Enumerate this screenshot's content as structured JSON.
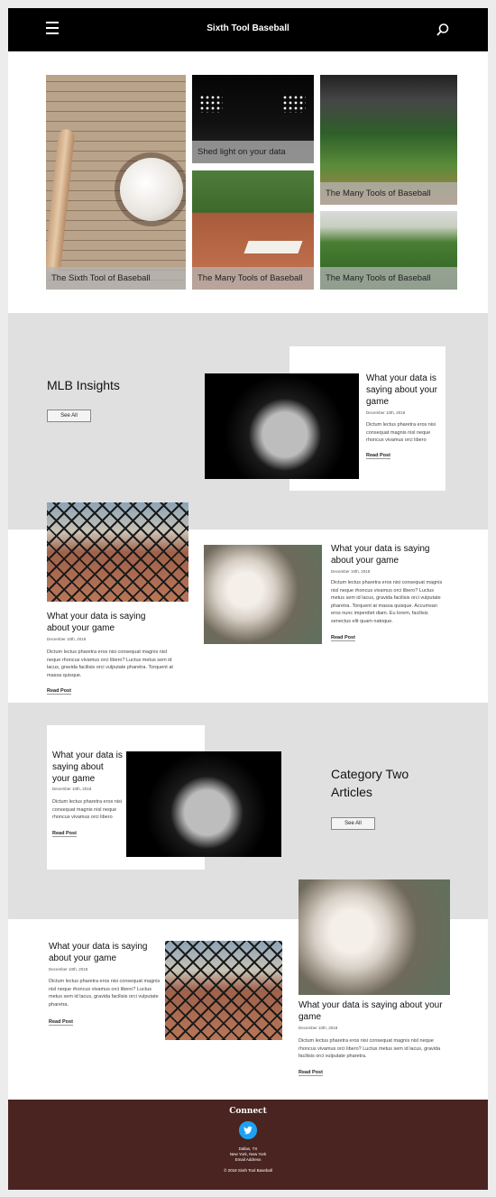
{
  "header": {
    "brand": "Sixth Tool Baseball",
    "menu_icon": "hamburger-icon",
    "search_icon": "search-icon"
  },
  "hero": {
    "tiles": [
      {
        "caption": "The Sixth Tool of Baseball"
      },
      {
        "caption": "Shed light on your data"
      },
      {
        "caption": "The Many Tools of Baseball"
      },
      {
        "caption": "The Many Tools of Baseball"
      },
      {
        "caption": "The Many Tools of Baseball"
      }
    ]
  },
  "mlb": {
    "title": "MLB Insights",
    "see_all": "See All",
    "featured": {
      "title": "What your data is saying about your game",
      "date": "December 10th, 2018",
      "excerpt": "Dictum lectus pharetra eros nisi consequat magnis nisl neque rhoncus vivamus orci libero",
      "read": "Read Post"
    },
    "posts": [
      {
        "title": "What your data is saying about your game",
        "date": "December 10th, 2018",
        "excerpt": "Dictum lectus pharetra eros nisi consequat magnis nisl neque rhoncus vivamus orci libero? Luctus metus sem id lacus, gravida facilisis orci vulputate pharetra. Torquent at massa quisque.",
        "read": "Read Post"
      },
      {
        "title": "What your data is saying about your game",
        "date": "December 10th, 2018",
        "excerpt": "Dictum lectus pharetra eros nisi consequat magnis nisl neque rhoncus vivamus orci libero? Luctus metus sem id lacus, gravida facilisis orci vulputate pharetra. Torquent at massa quisque. Accumsan eros nunc imperdiet diam. Eu lorem, facilisis senectus elit quam natoque.",
        "read": "Read Post"
      }
    ]
  },
  "cat2": {
    "title": "Category Two Articles",
    "see_all": "See All",
    "featured": {
      "title": "What your data is saying about your game",
      "date": "December 10th, 2018",
      "excerpt": "Dictum lectus pharetra eros nisi consequat magnis nisl neque rhoncus vivamus orci libero",
      "read": "Read Post"
    },
    "posts": [
      {
        "title": "What your data is saying about your game",
        "date": "December 10th, 2018",
        "excerpt": "Dictum lectus pharetra eros nisi consequat magnis nisl neque rhoncus vivamus orci libero? Luctus metus sem id lacus, gravida facilisis orci vulputate pharetra.",
        "read": "Read Post"
      },
      {
        "title": "What your data is saying about your game",
        "date": "December 10th, 2018",
        "excerpt": "Dictum lectus pharetra eros nisi consequat magnis nisl neque rhoncus vivamus orci libero? Luctus metus sem id lacus, gravida facilisis orci vulputate pharetra.",
        "read": "Read Post"
      }
    ]
  },
  "footer": {
    "connect": "Connect",
    "social_icon": "twitter-icon",
    "city": "Dallas, TX",
    "city2": "New York, New York",
    "email": "Email Address",
    "copyright": "© 2018 Sixth Tool Baseball"
  },
  "colors": {
    "header_bg": "#000000",
    "band_bg": "#e0e0e0",
    "footer_bg": "#4a2420",
    "twitter": "#1da1f2"
  }
}
